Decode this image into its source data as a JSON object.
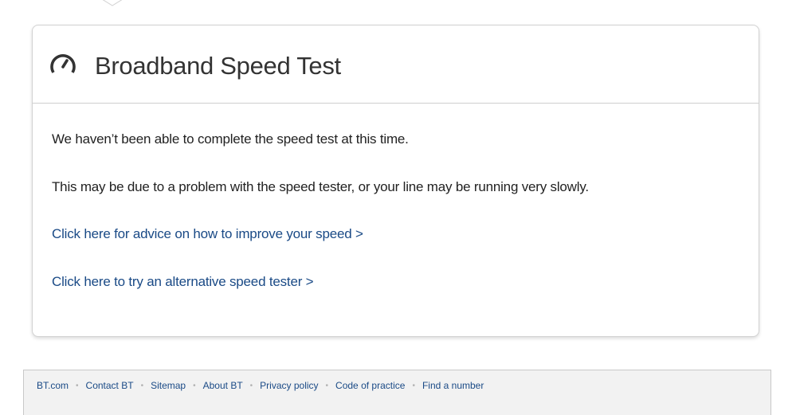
{
  "card": {
    "title": "Broadband Speed Test",
    "icon": "speedometer-icon",
    "paragraphs": [
      "We haven’t been able to complete the speed test at this time.",
      "This may be due to a problem with the speed tester, or your line may be running very slowly."
    ],
    "links": [
      "Click here for advice on how to improve your speed >",
      "Click here to try an alternative speed tester >"
    ]
  },
  "footer": {
    "links": [
      "BT.com",
      "Contact BT",
      "Sitemap",
      "About BT",
      "Privacy policy",
      "Code of practice",
      "Find a number"
    ],
    "separator": "•"
  },
  "colors": {
    "link": "#1a4a86",
    "text": "#222222",
    "title": "#333333",
    "footer_bg": "#f2f2f2"
  }
}
